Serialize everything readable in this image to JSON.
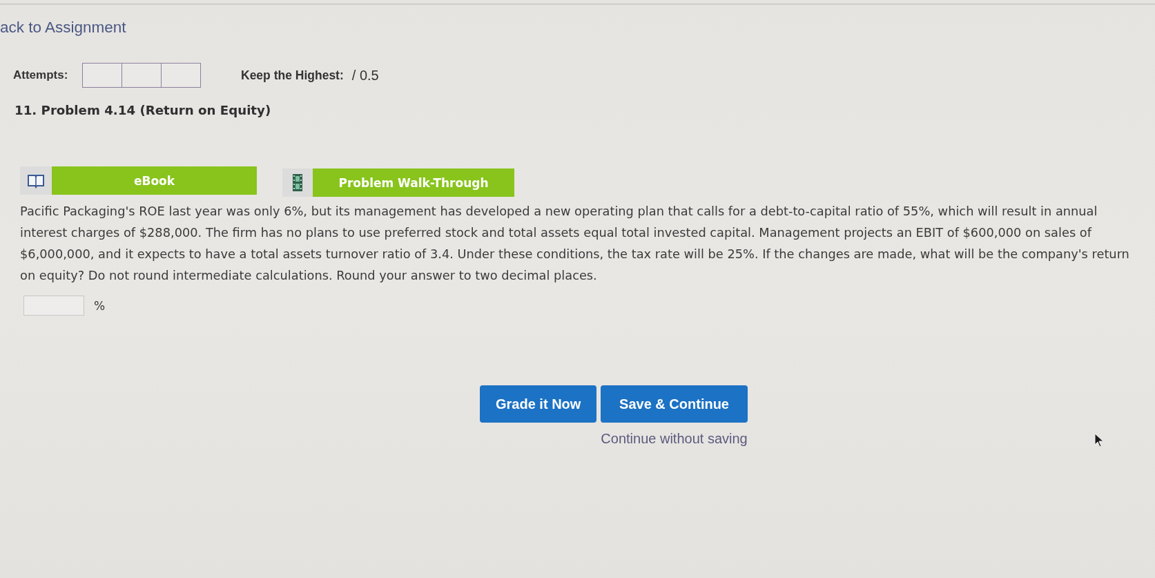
{
  "nav": {
    "back_link": "ack to Assignment"
  },
  "attempts": {
    "label": "Attempts:",
    "slots": [
      {
        "used": false
      },
      {
        "used": false
      },
      {
        "used": false
      }
    ]
  },
  "score": {
    "label": "Keep the Highest:",
    "value": "/ 0.5"
  },
  "problem": {
    "title": "11. Problem 4.14 (Return on Equity)"
  },
  "resources": [
    {
      "kind": "ebook",
      "label": "eBook"
    },
    {
      "kind": "video",
      "label": "Problem Walk-Through"
    }
  ],
  "question": {
    "text": "Pacific Packaging's ROE last year was only 6%, but its management has developed a new operating plan that calls for a debt-to-capital ratio of 55%, which will result in annual interest charges of $288,000. The firm has no plans to use preferred stock and total assets equal total invested capital. Management projects an EBIT of $600,000 on sales of $6,000,000, and it expects to have a total assets turnover ratio of 3.4. Under these conditions, the tax rate will be 25%. If the changes are made, what will be the company's return on equity? Do not round intermediate calculations. Round your answer to two decimal places."
  },
  "answer": {
    "unit": "%"
  },
  "buttons": [
    {
      "label": "Grade it Now"
    },
    {
      "label": "Save & Continue"
    }
  ],
  "secondary_link": {
    "label": "Continue without saving"
  }
}
